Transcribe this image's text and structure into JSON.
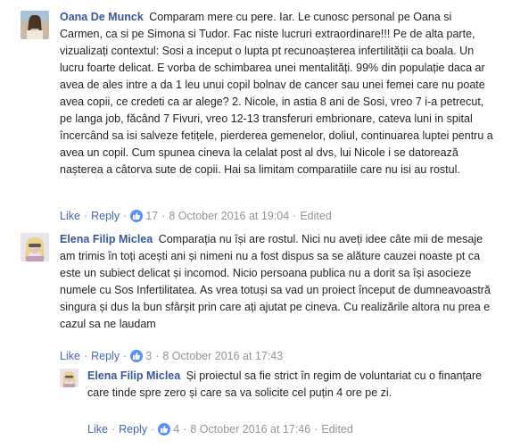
{
  "labels": {
    "like": "Like",
    "reply": "Reply",
    "edited": "Edited",
    "dot": "·"
  },
  "comments": [
    {
      "author": "Oana De Munck",
      "text": "Comparam mere cu pere. Iar. Le cunosc personal pe Oana si Carmen, ca si pe Simona si Tudor. Fac niste lucruri extraordinare!!! Pe de alta parte, vizualizați contextul: Sosi a inceput o lupta pt recunoașterea infertilității ca boala. Un lucru foarte delicat. E vorba de schimbarea unei mentalități. 99% din populație daca ar avea de ales intre a da 1 leu unui copil bolnav de cancer sau unei femei care nu poate avea copii, ce credeti ca ar alege? 2. Nicole, in astia 8 ani de Sosi, vreo 7 i-a petrecut, pe langa job, făcând 7 Fivuri, vreo 12-13 transferuri embrionare, cateva luni in spital încercând sa isi salveze fetițele, pierderea gemenelor, doliul, continuarea luptei pentru a avea un copil. Cum spunea cineva la celalat post al dvs, lui Nicole i se datorează nașterea a câtorva sute de copii. Hai sa limitam comparatiile care nu isi au rostul.",
      "likes": "17",
      "date": "8 October 2016 at 19:04"
    },
    {
      "author": "Elena Filip Miclea",
      "text": "Comparația nu își are rostul. Nici nu aveți idee câte mii de mesaje am trimis în toți acești ani și nimeni nu a fost dispus sa se alăture cauzei noaste pt ca este un subiect delicat și incomod. Nicio persoana publica nu a dorit sa își asocieze numele cu Sos Infertilitatea. As vrea totuși sa vad un proiect început de dumneavoastră singura și dus la bun sfârșit prin care ați ajutat pe cineva. Cu realizările altora nu prea e cazul sa ne laudam",
      "likes": "3",
      "date": "8 October 2016 at 17:43"
    },
    {
      "author": "Elena Filip Miclea",
      "text": "Și proiectul sa fie strict în regim de voluntariat cu o finanțare care tinde spre zero și care sa va solicite cel puțin 4 ore pe zi.",
      "likes": "4",
      "date": "8 October 2016 at 17:46",
      "edited": true
    }
  ]
}
